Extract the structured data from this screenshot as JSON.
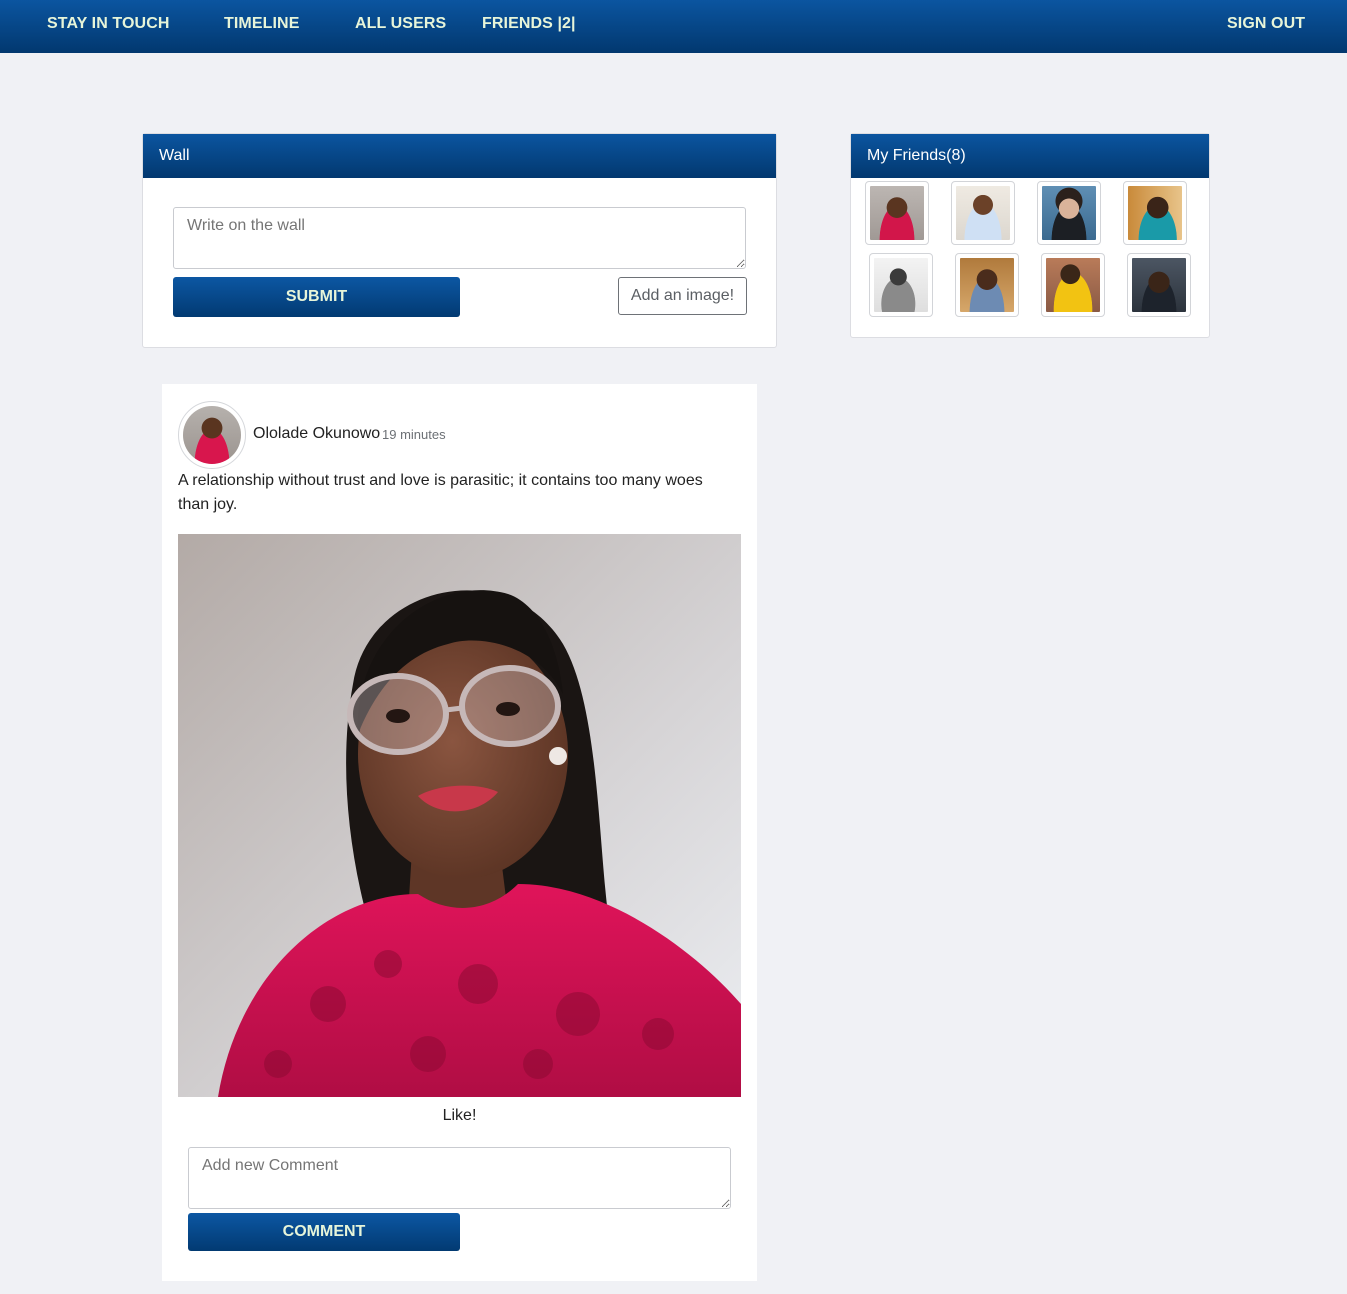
{
  "nav": {
    "brand": "STAY IN TOUCH",
    "timeline": "TIMELINE",
    "all_users": "ALL USERS",
    "friends": "FRIENDS |2|",
    "sign_out": "SIGN OUT"
  },
  "wall": {
    "title": "Wall",
    "placeholder": "Write on the wall",
    "submit_label": "SUBMIT",
    "add_image_label": "Add an image!"
  },
  "friends_panel": {
    "title": "My Friends(8)"
  },
  "post": {
    "author": "Ololade Okunowo",
    "time": "19 minutes",
    "text": "A relationship without trust and love is parasitic; it contains too many woes than joy.",
    "like_label": "Like!",
    "comment_placeholder": "Add new Comment",
    "comment_label": "COMMENT"
  },
  "colors": {
    "navbar": "#02386f",
    "nav_text": "#e7f5d9",
    "background": "#f0f1f5"
  }
}
